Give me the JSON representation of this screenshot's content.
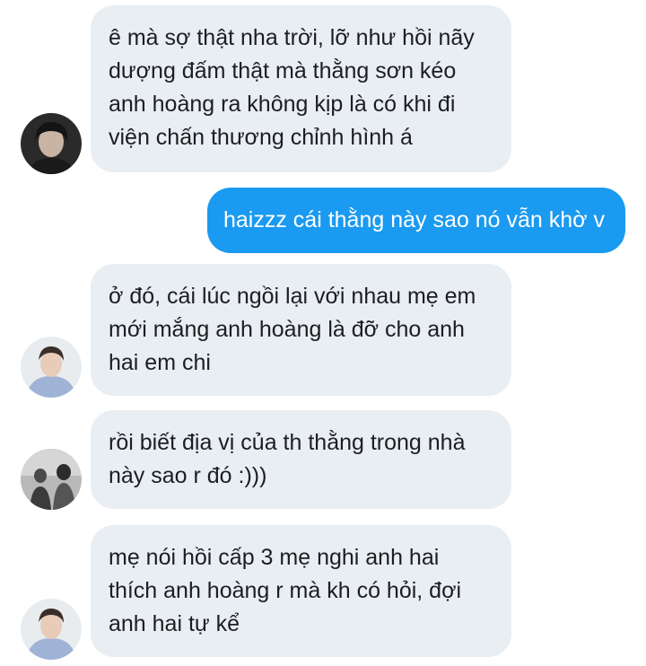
{
  "conversation": {
    "messages": [
      {
        "id": 1,
        "direction": "incoming",
        "avatar": "avatar-dark-hair-icon",
        "text": "ê mà sợ thật nha trời, lỡ như hồi nãy\ndượng đấm thật mà thằng sơn kéo\nanh hoàng ra không kịp là có khi đi\nviện chấn thương chỉnh hình á"
      },
      {
        "id": 2,
        "direction": "outgoing",
        "text": "haizzz cái thằng này sao nó vẫn khờ v"
      },
      {
        "id": 3,
        "direction": "incoming",
        "avatar": "avatar-light-hoodie-icon",
        "text": "ở đó, cái lúc ngồi lại với nhau mẹ em\nmới mắng anh hoàng là đỡ cho anh\nhai em chi"
      },
      {
        "id": 4,
        "direction": "incoming",
        "avatar": "avatar-group-photo-icon",
        "text": "rồi biết địa vị của th thằng trong nhà\nnày sao r đó :)))"
      },
      {
        "id": 5,
        "direction": "incoming",
        "avatar": "avatar-light-hoodie-icon",
        "text": "mẹ nói hồi cấp 3 mẹ nghi anh hai\nthích anh hoàng r mà kh có hỏi, đợi\nanh hai tự kể"
      }
    ]
  },
  "colors": {
    "incoming_bubble": "#e9eef3",
    "outgoing_bubble": "#1a9af0",
    "incoming_text": "#1c1e21",
    "outgoing_text": "#ffffff"
  }
}
